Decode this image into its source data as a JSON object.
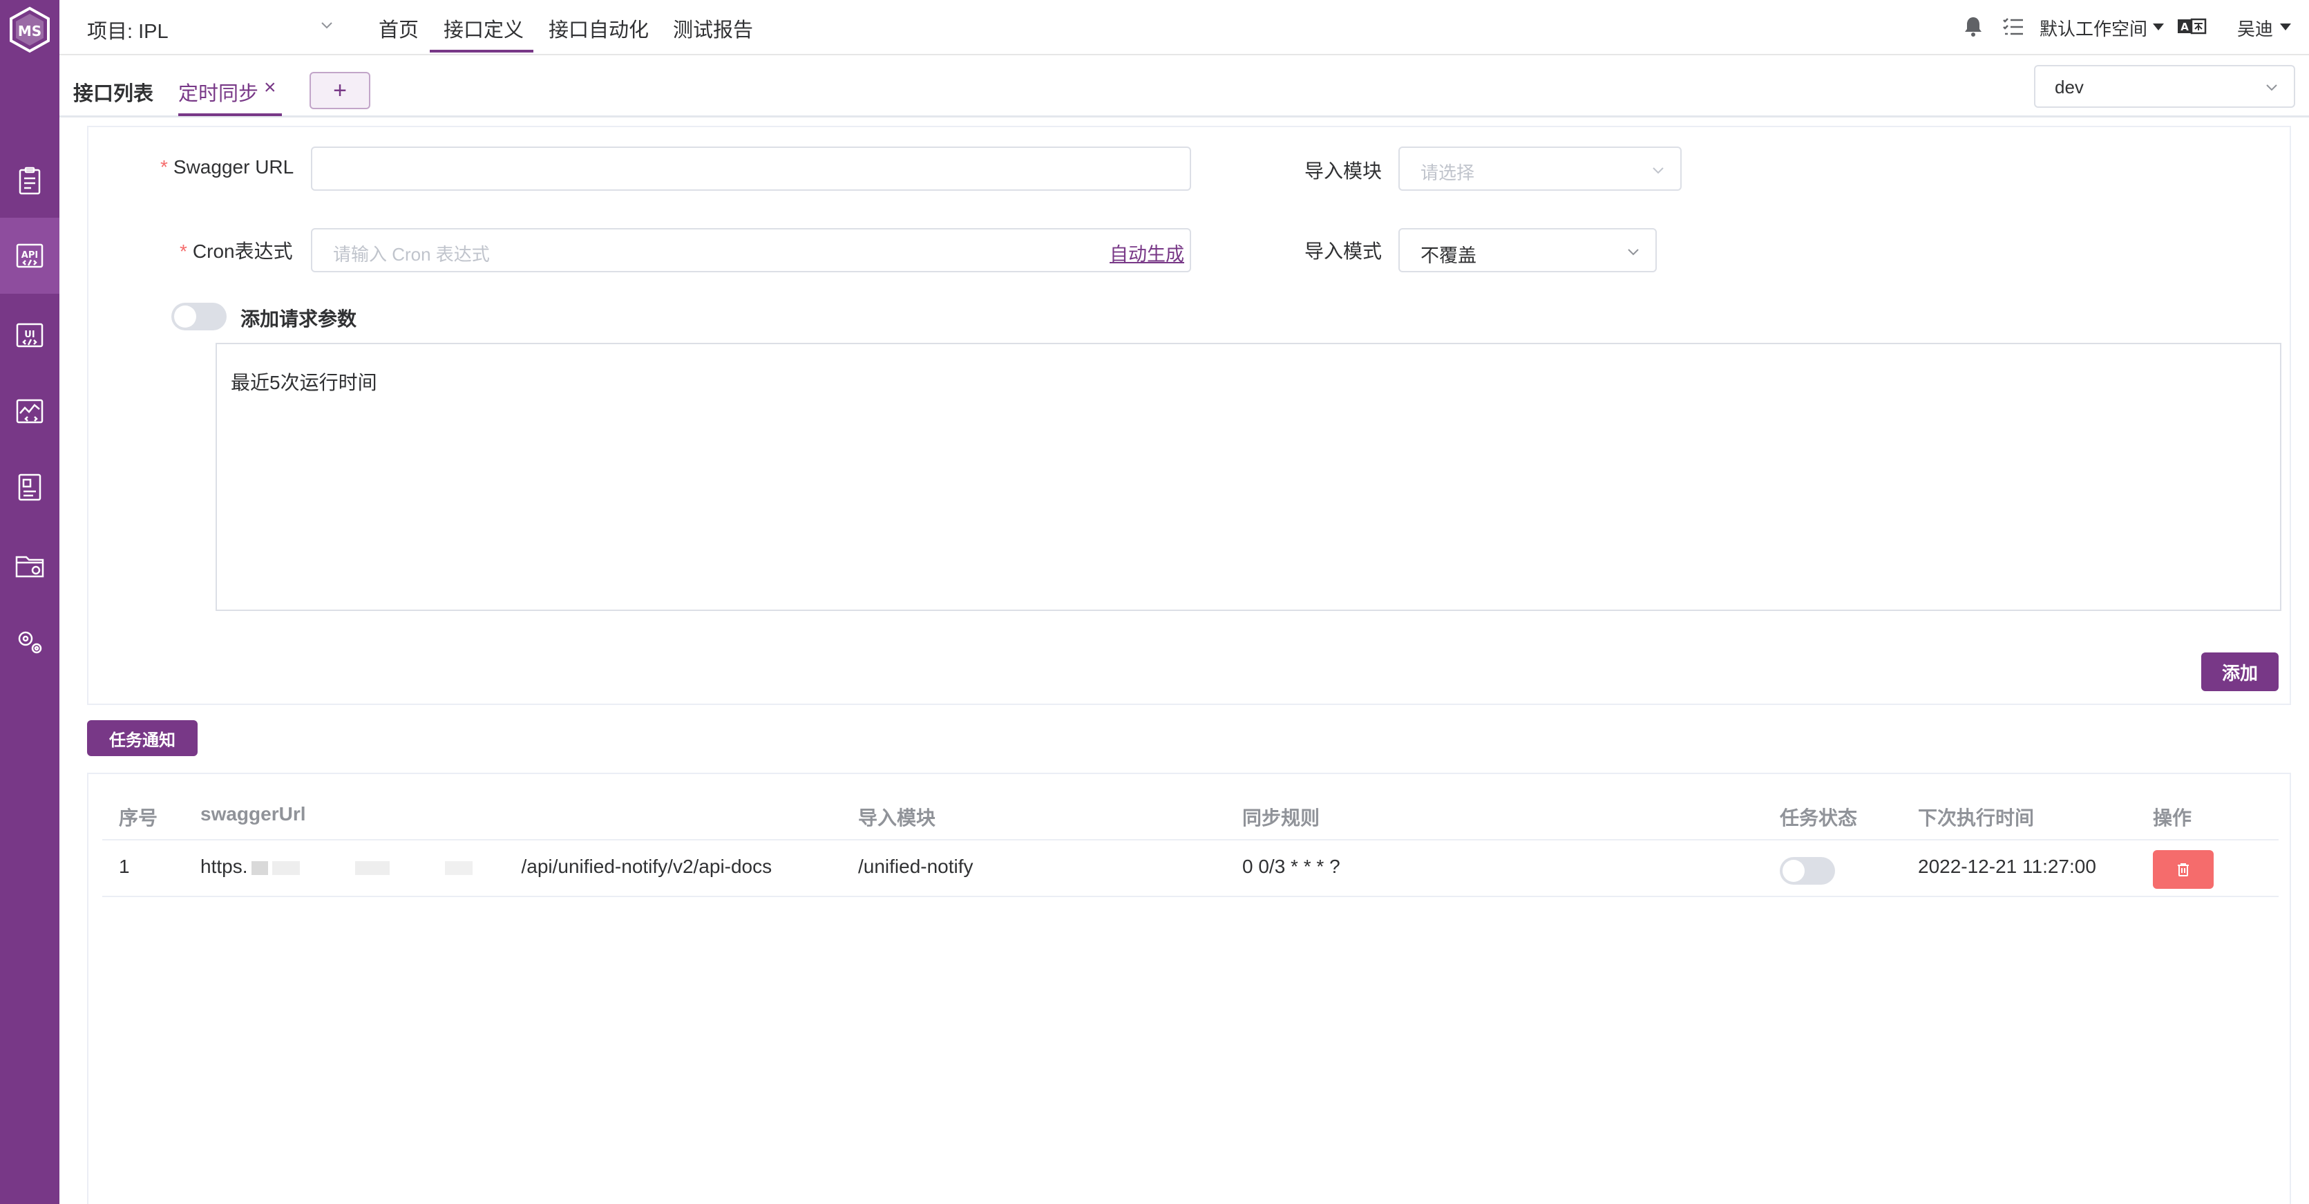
{
  "header": {
    "project": "项目: IPL",
    "menu": [
      "首页",
      "接口定义",
      "接口自动化",
      "测试报告"
    ],
    "workspace": "默认工作空间",
    "user": "吴迪"
  },
  "tabs": {
    "list": "接口列表",
    "current": "定时同步",
    "close": "×",
    "add": "+",
    "env": "dev"
  },
  "form": {
    "swagger_label": "Swagger URL",
    "swagger_value": "",
    "module_label": "导入模块",
    "module_placeholder": "请选择",
    "cron_label": "Cron表达式",
    "cron_placeholder": "请输入 Cron 表达式",
    "auto_generate": "自动生成",
    "mode_label": "导入模式",
    "mode_value": "不覆盖",
    "params_label": "添加请求参数",
    "recent_runs": "最近5次运行时间",
    "add_button": "添加",
    "required_mark": "*"
  },
  "notify_button": "任务通知",
  "table": {
    "headers": [
      "序号",
      "swaggerUrl",
      "导入模块",
      "同步规则",
      "任务状态",
      "下次执行时间",
      "操作"
    ],
    "rows": [
      {
        "index": "1",
        "url_prefix": "https.",
        "url_suffix": "/api/unified-notify/v2/api-docs",
        "module": "/unified-notify",
        "rule": "0 0/3 * * * ?",
        "next_time": "2022-12-21 11:27:00"
      }
    ]
  },
  "icons": {
    "sidebar": [
      "ms-logo-icon",
      "track-icon",
      "api-icon",
      "ui-icon",
      "performance-icon",
      "report-icon",
      "project-icon",
      "settings-icon"
    ],
    "topbar": [
      "bell-icon",
      "workspace-list-icon",
      "language-icon"
    ]
  },
  "colors": {
    "primary": "#783887",
    "danger": "#f56c6c",
    "sidebar_active": "#8e4d9e"
  }
}
